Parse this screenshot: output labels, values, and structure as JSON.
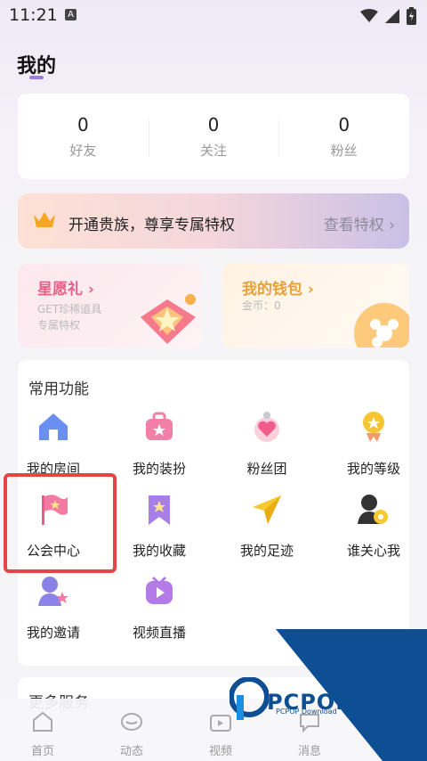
{
  "status": {
    "time": "11:21",
    "notif": "A"
  },
  "page": {
    "title": "我的"
  },
  "stats": [
    {
      "value": "0",
      "label": "好友"
    },
    {
      "value": "0",
      "label": "关注"
    },
    {
      "value": "0",
      "label": "粉丝"
    }
  ],
  "vip": {
    "text": "开通贵族，尊享专属特权",
    "link": "查看特权",
    "accent": "#f5a623"
  },
  "promos": {
    "left": {
      "title": "星愿礼",
      "sub1": "GET珍稀道具",
      "sub2": "专属特权",
      "color": "#e8618a"
    },
    "right": {
      "title": "我的钱包",
      "sub": "金币：0",
      "color": "#e8a13b"
    }
  },
  "features": {
    "title": "常用功能",
    "items": [
      {
        "label": "我的房间",
        "icon": "house-icon"
      },
      {
        "label": "我的装扮",
        "icon": "dressup-icon"
      },
      {
        "label": "粉丝团",
        "icon": "fan-club-icon"
      },
      {
        "label": "我的等级",
        "icon": "medal-icon"
      },
      {
        "label": "公会中心",
        "icon": "flag-icon"
      },
      {
        "label": "我的收藏",
        "icon": "bookmark-icon"
      },
      {
        "label": "我的足迹",
        "icon": "send-icon"
      },
      {
        "label": "谁关心我",
        "icon": "visitor-icon"
      },
      {
        "label": "我的邀请",
        "icon": "invite-icon"
      },
      {
        "label": "视频直播",
        "icon": "video-live-icon"
      }
    ]
  },
  "more": {
    "title": "更多服务"
  },
  "nav": [
    {
      "label": "首页"
    },
    {
      "label": "动态"
    },
    {
      "label": "视频"
    },
    {
      "label": "消息"
    }
  ],
  "watermark": {
    "text": "PCPOP下载",
    "sub": "PCPOP Download"
  },
  "colors": {
    "highlight": "#e84444",
    "brand": "#9b7fe0"
  }
}
